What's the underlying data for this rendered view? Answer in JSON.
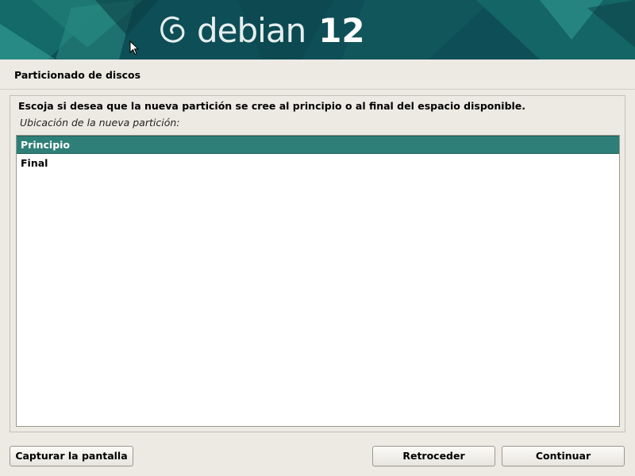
{
  "banner": {
    "brand_name": "debian",
    "brand_version": "12",
    "logo_icon": "debian-swirl-icon",
    "colors": {
      "dark": "#0e4e56",
      "mid": "#1f7a74",
      "light": "#3aa9a0"
    }
  },
  "section_title": "Particionado de discos",
  "question": "Escoja si desea que la nueva partición se cree al principio o al final del espacio disponible.",
  "field_label": "Ubicación de la nueva partición:",
  "options": [
    {
      "label": "Principio",
      "selected": true
    },
    {
      "label": "Final",
      "selected": false
    }
  ],
  "buttons": {
    "capture": "Capturar la pantalla",
    "back": "Retroceder",
    "continue": "Continuar"
  },
  "colors": {
    "selection": "#2e7f77",
    "background": "#edeae3"
  }
}
